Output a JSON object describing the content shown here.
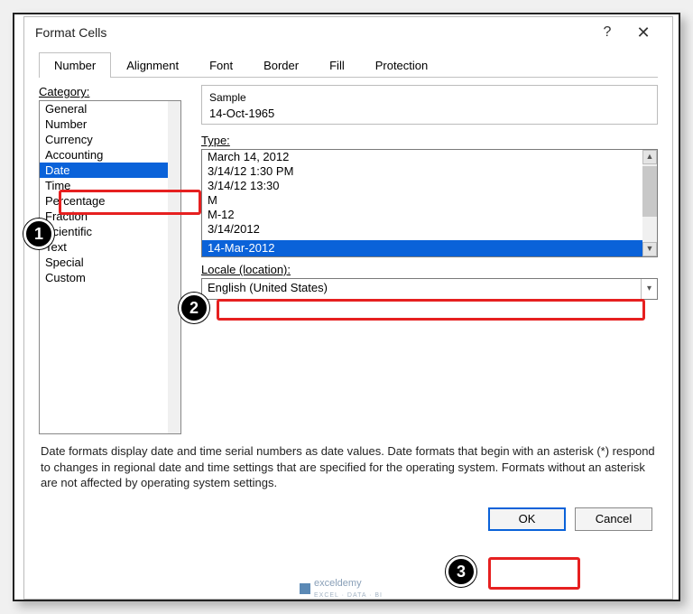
{
  "dialog": {
    "title": "Format Cells",
    "help": "?",
    "close": "✕"
  },
  "tabs": [
    "Number",
    "Alignment",
    "Font",
    "Border",
    "Fill",
    "Protection"
  ],
  "category": {
    "label": "Category:",
    "items": [
      "General",
      "Number",
      "Currency",
      "Accounting",
      "Date",
      "Time",
      "Percentage",
      "Fraction",
      "Scientific",
      "Text",
      "Special",
      "Custom"
    ],
    "selected": "Date"
  },
  "sample": {
    "label": "Sample",
    "value": "14-Oct-1965"
  },
  "type": {
    "label": "Type:",
    "items": [
      "March 14, 2012",
      "3/14/12 1:30 PM",
      "3/14/12 13:30",
      "M",
      "M-12",
      "3/14/2012",
      "14-Mar-2012"
    ],
    "selected": "14-Mar-2012"
  },
  "locale": {
    "label": "Locale (location):",
    "value": "English (United States)"
  },
  "description": "Date formats display date and time serial numbers as date values.  Date formats that begin with an asterisk (*) respond to changes in regional date and time settings that are specified for the operating system. Formats without an asterisk are not affected by operating system settings.",
  "buttons": {
    "ok": "OK",
    "cancel": "Cancel"
  },
  "badges": {
    "one": "1",
    "two": "2",
    "three": "3"
  },
  "watermark": {
    "name": "exceldemy",
    "sub": "EXCEL · DATA · BI"
  }
}
